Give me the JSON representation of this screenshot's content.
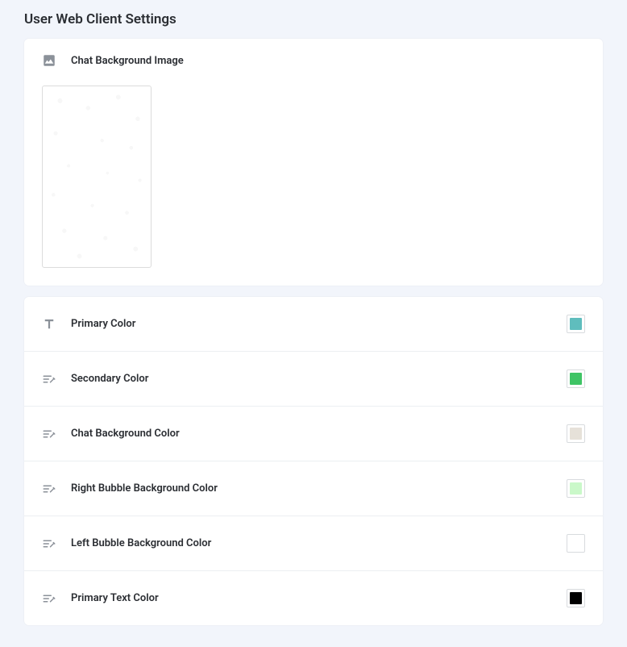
{
  "page_title": "User Web Client Settings",
  "bg_image_section": {
    "label": "Chat Background Image"
  },
  "color_settings": [
    {
      "id": "primary-color",
      "label": "Primary Color",
      "icon": "text",
      "value": "#5fbdbd"
    },
    {
      "id": "secondary-color",
      "label": "Secondary Color",
      "icon": "swatches",
      "value": "#3fc465"
    },
    {
      "id": "chat-background-color",
      "label": "Chat Background Color",
      "icon": "swatches",
      "value": "#e6e1d9"
    },
    {
      "id": "right-bubble-bg-color",
      "label": "Right Bubble Background Color",
      "icon": "swatches",
      "value": "#caf8c9"
    },
    {
      "id": "left-bubble-bg-color",
      "label": "Left Bubble Background Color",
      "icon": "swatches",
      "value": "#ffffff"
    },
    {
      "id": "primary-text-color",
      "label": "Primary Text Color",
      "icon": "swatches",
      "value": "#000000"
    }
  ]
}
